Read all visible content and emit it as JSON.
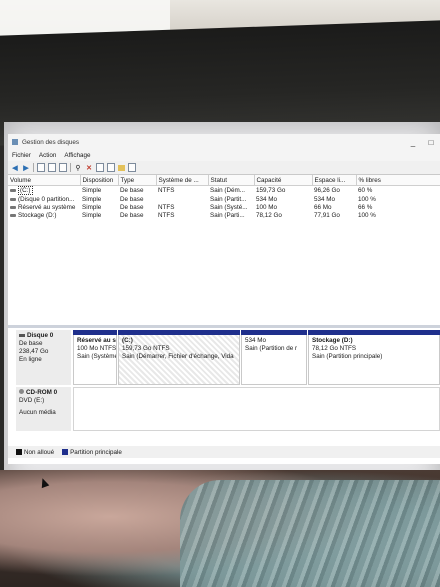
{
  "window": {
    "title": "Gestion des disques",
    "minimize": "_",
    "maximize": "□"
  },
  "menu": [
    "Fichier",
    "Action",
    "Affichage"
  ],
  "toolbar_icons": [
    "back-arrow-icon",
    "forward-arrow-icon",
    "panel-icon",
    "help-icon",
    "properties-icon",
    "connect-icon",
    "delete-x-icon",
    "check-icon",
    "new-doc-icon",
    "folder-icon",
    "settings-icon"
  ],
  "volume_table": {
    "columns": [
      "Volume",
      "Disposition",
      "Type",
      "Système de ...",
      "Statut",
      "Capacité",
      "Espace li...",
      "% libres"
    ],
    "rows": [
      {
        "volume": "(C:)",
        "layout": "Simple",
        "type": "De base",
        "fs": "NTFS",
        "status": "Sain (Dém...",
        "capacity": "159,73 Go",
        "free": "96,26 Go",
        "pct": "60 %"
      },
      {
        "volume": "(Disque 0 partition...",
        "layout": "Simple",
        "type": "De base",
        "fs": "",
        "status": "Sain (Partit...",
        "capacity": "534 Mo",
        "free": "534 Mo",
        "pct": "100 %"
      },
      {
        "volume": "Réservé au système",
        "layout": "Simple",
        "type": "De base",
        "fs": "NTFS",
        "status": "Sain (Systé...",
        "capacity": "100 Mo",
        "free": "66 Mo",
        "pct": "66 %"
      },
      {
        "volume": "Stockage (D:)",
        "layout": "Simple",
        "type": "De base",
        "fs": "NTFS",
        "status": "Sain (Parti...",
        "capacity": "78,12 Go",
        "free": "77,91 Go",
        "pct": "100 %"
      }
    ]
  },
  "disk0": {
    "name": "Disque 0",
    "type": "De base",
    "size": "238,47 Go",
    "state": "En ligne",
    "partitions": [
      {
        "name": "Réservé au s",
        "size": "100 Mo NTFS",
        "status": "Sain (Système"
      },
      {
        "name": "(C:)",
        "size": "159,73 Go NTFS",
        "status": "Sain (Démarrer, Fichier d'échange, Vida"
      },
      {
        "name": "",
        "size": "534 Mo",
        "status": "Sain (Partition de r"
      },
      {
        "name": "Stockage (D:)",
        "size": "78,12 Go NTFS",
        "status": "Sain (Partition principale)"
      }
    ]
  },
  "cdrom0": {
    "name": "CD-ROM 0",
    "drive": "DVD (E:)",
    "media": "Aucun média"
  },
  "legend": [
    {
      "label": "Non alloué",
      "color": "#111111"
    },
    {
      "label": "Partition principale",
      "color": "#1f2f8c"
    }
  ]
}
